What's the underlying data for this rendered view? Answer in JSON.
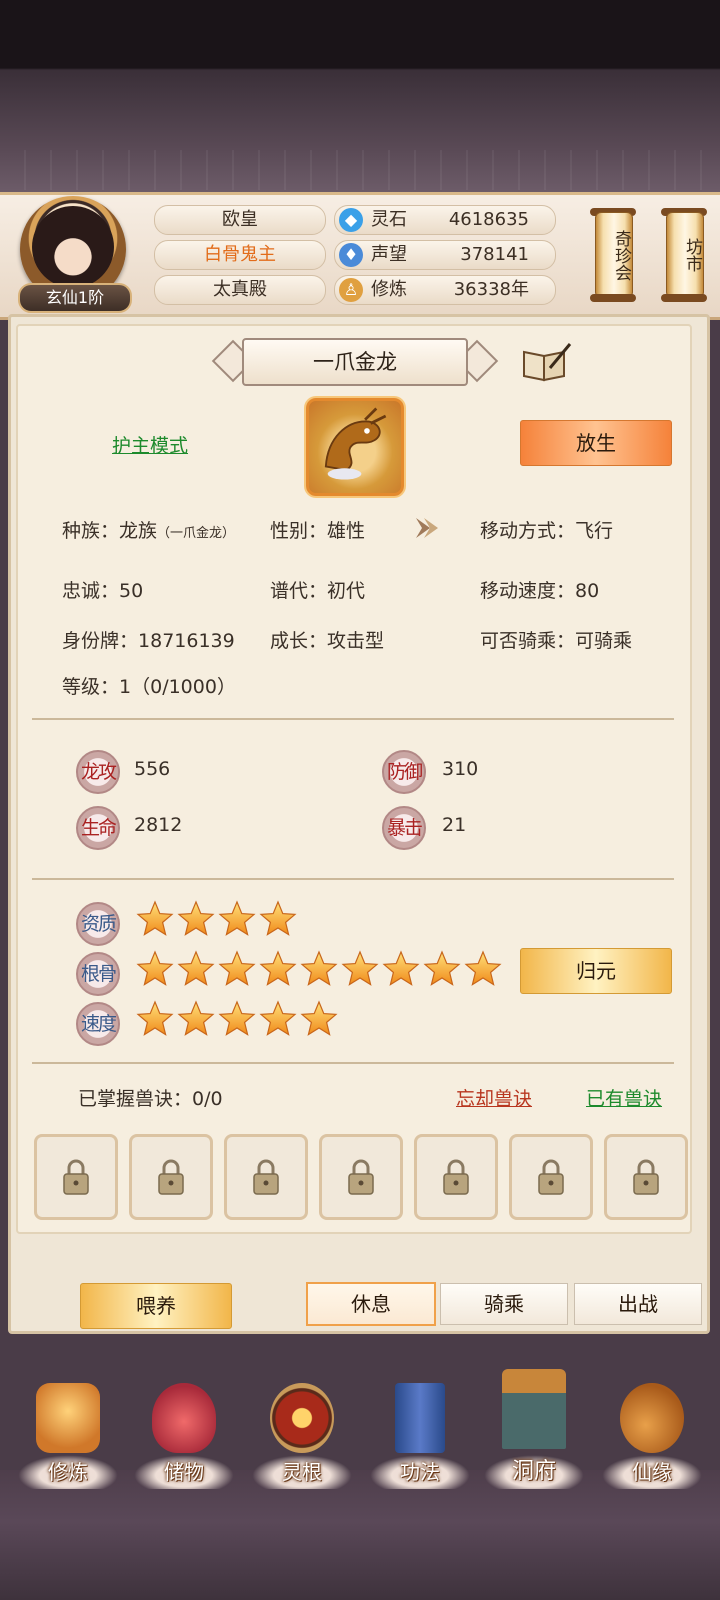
{
  "player": {
    "rank": "玄仙1阶",
    "tags": [
      "欧皇",
      "白骨鬼主",
      "太真殿"
    ]
  },
  "resources": [
    {
      "label": "灵石",
      "value": "4618635",
      "icon": "spirit-stone-icon",
      "color": "#3aa0e8"
    },
    {
      "label": "声望",
      "value": "378141",
      "icon": "reputation-crystal-icon",
      "color": "#4a8ad8"
    },
    {
      "label": "修炼",
      "value": "36338年",
      "icon": "meditation-icon",
      "color": "#e0a040"
    }
  ],
  "side_buttons": {
    "treasure_fair": "奇珍会",
    "market": "坊市"
  },
  "pet": {
    "name": "一爪金龙",
    "guard_mode": "护主模式",
    "release": "放生",
    "info": {
      "race_label": "种族：",
      "race": "龙族",
      "race_sub": "（一爪金龙）",
      "gender_label": "性别：",
      "gender": "雄性",
      "move_label": "移动方式：",
      "move": "飞行",
      "loyalty_label": "忠诚：",
      "loyalty": "50",
      "gen_label": "谱代：",
      "gen": "初代",
      "speed_label": "移动速度：",
      "speed": "80",
      "id_label": "身份牌：",
      "id": "18716139",
      "growth_label": "成长：",
      "growth": "攻击型",
      "ride_label": "可否骑乘：",
      "ride": "可骑乘",
      "level_label": "等级：",
      "level": "1（0/1000）"
    },
    "stats": [
      {
        "label": "龙攻",
        "value": "556"
      },
      {
        "label": "防御",
        "value": "310"
      },
      {
        "label": "生命",
        "value": "2812"
      },
      {
        "label": "暴击",
        "value": "21"
      }
    ],
    "ratings": [
      {
        "label": "资质",
        "stars": 4
      },
      {
        "label": "根骨",
        "stars": 9
      },
      {
        "label": "速度",
        "stars": 5
      }
    ],
    "reset": "归元",
    "skills": {
      "mastered": "已掌握兽诀：0/0",
      "forget": "忘却兽诀",
      "owned": "已有兽诀",
      "slots": 7
    }
  },
  "actions": {
    "feed": "喂养",
    "rest": "休息",
    "ride": "骑乘",
    "battle": "出战"
  },
  "nav": [
    "修炼",
    "储物",
    "灵根",
    "功法",
    "洞府",
    "仙缘"
  ]
}
